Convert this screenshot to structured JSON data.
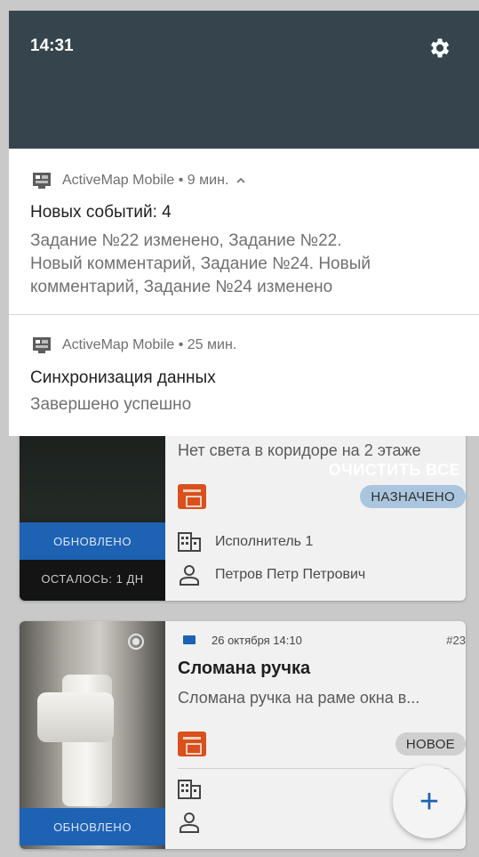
{
  "status_bar": {
    "time": "14:31",
    "settings_icon": "gear-icon"
  },
  "notifications": [
    {
      "app_name": "ActiveMap Mobile",
      "time_ago": "• 9 мин.",
      "expand_icon": "chevron-up-icon",
      "title": "Новых событий: 4",
      "body_lines": [
        "Задание №22 изменено, Задание №22.",
        "Новый комментарий, Задание №24. Новый",
        "комментарий, Задание №24 изменено"
      ]
    },
    {
      "app_name": "ActiveMap Mobile",
      "time_ago": "• 25 мин.",
      "title": "Синхронизация данных",
      "body": "Завершено успешно"
    }
  ],
  "clear_all_label": "ОЧИСТИТЬ ВСЕ",
  "tasks": [
    {
      "description": "Нет света в коридоре на 2 этаже",
      "status_chip": "НАЗНАЧЕНО",
      "band_updated": "ОБНОВЛЕНО",
      "band_remaining": "ОСТАЛОСЬ: 1 ДН",
      "executor": "Исполнитель 1",
      "person": "Петров Петр Петрович"
    },
    {
      "date": "26 октября 14:10",
      "number": "#23",
      "title": "Сломана ручка",
      "description": "Сломана ручка на раме окна в...",
      "status_chip": "НОВОЕ",
      "band_updated": "ОБНОВЛЕНО"
    }
  ],
  "fab_label": "+",
  "colors": {
    "shade_header": "#36444d",
    "accent_blue": "#1e62b4",
    "task_icon": "#d9501c"
  }
}
